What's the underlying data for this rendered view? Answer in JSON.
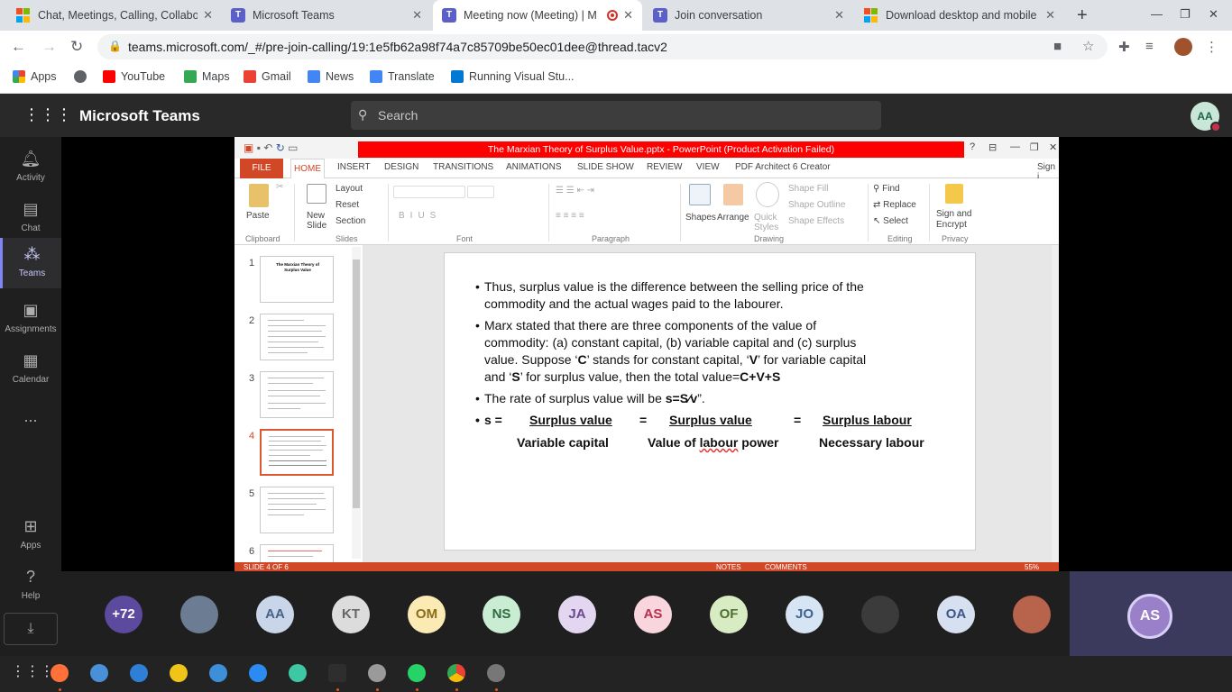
{
  "browser": {
    "tabs": [
      {
        "title": "Chat, Meetings, Calling, Collabo",
        "icon": "microsoft-logo"
      },
      {
        "title": "Microsoft Teams",
        "icon": "teams-logo"
      },
      {
        "title": "Meeting now (Meeting) | M",
        "icon": "teams-logo",
        "active": true
      },
      {
        "title": "Join conversation",
        "icon": "teams-logo"
      },
      {
        "title": "Download desktop and mobile",
        "icon": "microsoft-logo"
      }
    ],
    "url": "teams.microsoft.com/_#/pre-join-calling/19:1e5fb62a98f74a7c85709be50ec01dee@thread.tacv2",
    "bookmarks": [
      "Apps",
      "YouTube",
      "Maps",
      "Gmail",
      "News",
      "Translate",
      "Running Visual Stu..."
    ]
  },
  "teams": {
    "app_name": "Microsoft Teams",
    "search_placeholder": "Search",
    "user_initials": "AA",
    "rail": [
      "Activity",
      "Chat",
      "Teams",
      "Assignments",
      "Calendar",
      "...",
      "Apps",
      "Help"
    ]
  },
  "ppt": {
    "window_title": "The Marxian Theory of Surplus Value.pptx - PowerPoint (Product Activation Failed)",
    "tabs": [
      "FILE",
      "HOME",
      "INSERT",
      "DESIGN",
      "TRANSITIONS",
      "ANIMATIONS",
      "SLIDE SHOW",
      "REVIEW",
      "VIEW",
      "PDF Architect 6 Creator"
    ],
    "sign_in": "Sign i",
    "ribbon": {
      "paste": "Paste",
      "new_slide": "New Slide",
      "layout": "Layout",
      "reset": "Reset",
      "section": "Section",
      "shapes": "Shapes",
      "arrange": "Arrange",
      "quick_styles": "Quick Styles",
      "shape_fill": "Shape Fill",
      "shape_outline": "Shape Outline",
      "shape_effects": "Shape Effects",
      "find": "Find",
      "replace": "Replace",
      "select": "Select",
      "sign_encrypt": "Sign and Encrypt",
      "groups": [
        "Clipboard",
        "Slides",
        "Font",
        "Paragraph",
        "Drawing",
        "Editing",
        "Privacy"
      ]
    },
    "thumb_numbers": [
      "1",
      "2",
      "3",
      "4",
      "5",
      "6"
    ],
    "thumb1_title": "The Marxian Theory of Surplus Value",
    "slide": {
      "b1": "Thus, surplus value is the difference between the selling price of the commodity and the actual wages paid to the labourer.",
      "b2_lines": [
        "Marx stated that there are three components of the value of",
        "commodity: (a) constant capital, (b) variable capital and (c) surplus"
      ],
      "b2_l3_a": "value. Suppose ‘",
      "b2_l3_C": "C",
      "b2_l3_b": "’ stands for constant capital, ‘",
      "b2_l3_V": "V",
      "b2_l3_c": "’ for variable capital",
      "b2_l4_a": "and ‘",
      "b2_l4_S": "S",
      "b2_l4_b": "’ for surplus value, then the total value=",
      "b2_l4_f": "C+V+S",
      ".": ".",
      "b3_a": "The rate of surplus value will be ",
      "b3_f": "s=S⁄v",
      "b3_b": "”.",
      "s_eq": "s =",
      "num1": "Surplus value",
      "eq": "=",
      "num2": "Surplus value",
      "num3": "Surplus labour",
      "den1": "Variable capital",
      "den2_a": "Value of ",
      "den2_u": "labour",
      "den2_b": " power",
      "den3": "Necessary labour"
    },
    "status": {
      "slide": "SLIDE 4 OF 6",
      "notes": "NOTES",
      "comments": "COMMENTS",
      "zoom": "55%"
    }
  },
  "gallery": [
    {
      "label": "+72",
      "bg": "#5b4a9e",
      "fg": "#fff"
    },
    {
      "label": "",
      "bg": "#6c7d93",
      "fg": "#fff",
      "photo": true
    },
    {
      "label": "AA",
      "bg": "#c9d6ea",
      "fg": "#47618a"
    },
    {
      "label": "KT",
      "bg": "#dcdcdc",
      "fg": "#666"
    },
    {
      "label": "OM",
      "bg": "#fbeab4",
      "fg": "#8a6d1a"
    },
    {
      "label": "NS",
      "bg": "#c9ecd3",
      "fg": "#2f6b3f"
    },
    {
      "label": "JA",
      "bg": "#e3d6f1",
      "fg": "#6a4a8f"
    },
    {
      "label": "AS",
      "bg": "#f9d6dd",
      "fg": "#b6304e"
    },
    {
      "label": "OF",
      "bg": "#d8ecc4",
      "fg": "#4f7030"
    },
    {
      "label": "JO",
      "bg": "#d6e4f3",
      "fg": "#3d6490"
    },
    {
      "label": "",
      "bg": "#3b3b3b",
      "fg": "#fff",
      "photo": true
    },
    {
      "label": "OA",
      "bg": "#d6e0f0",
      "fg": "#3d5688"
    },
    {
      "label": "",
      "bg": "#b8634b",
      "fg": "#fff",
      "photo": true
    }
  ],
  "self_initials": "AS"
}
